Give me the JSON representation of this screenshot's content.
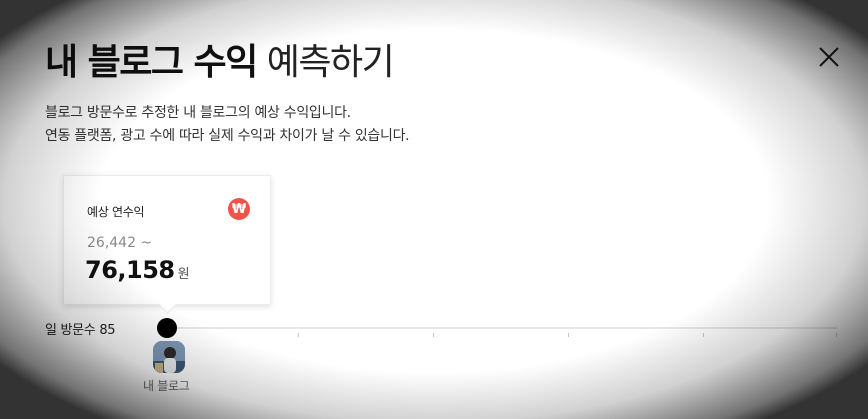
{
  "modal": {
    "title_strong": "내 블로그 수익",
    "title_light": "예측하기",
    "description_line1": "블로그 방문수로 추정한 내 블로그의 예상 수익입니다.",
    "description_line2": "연동 플랫폼, 광고 수에 따라 실제 수익과 차이가 날 수 있습니다.",
    "close_icon": "close-icon"
  },
  "estimate_card": {
    "label": "예상 연수익",
    "badge_symbol": "₩",
    "badge_icon": "won-icon",
    "badge_color": "#f0534a",
    "range_min": "26,442 ~",
    "range_max": "76,158",
    "unit": "원"
  },
  "visits_slider": {
    "label": "일 방문수",
    "value": "85",
    "position_fraction": 0.0
  },
  "avatar": {
    "caption": "내 블로그"
  }
}
